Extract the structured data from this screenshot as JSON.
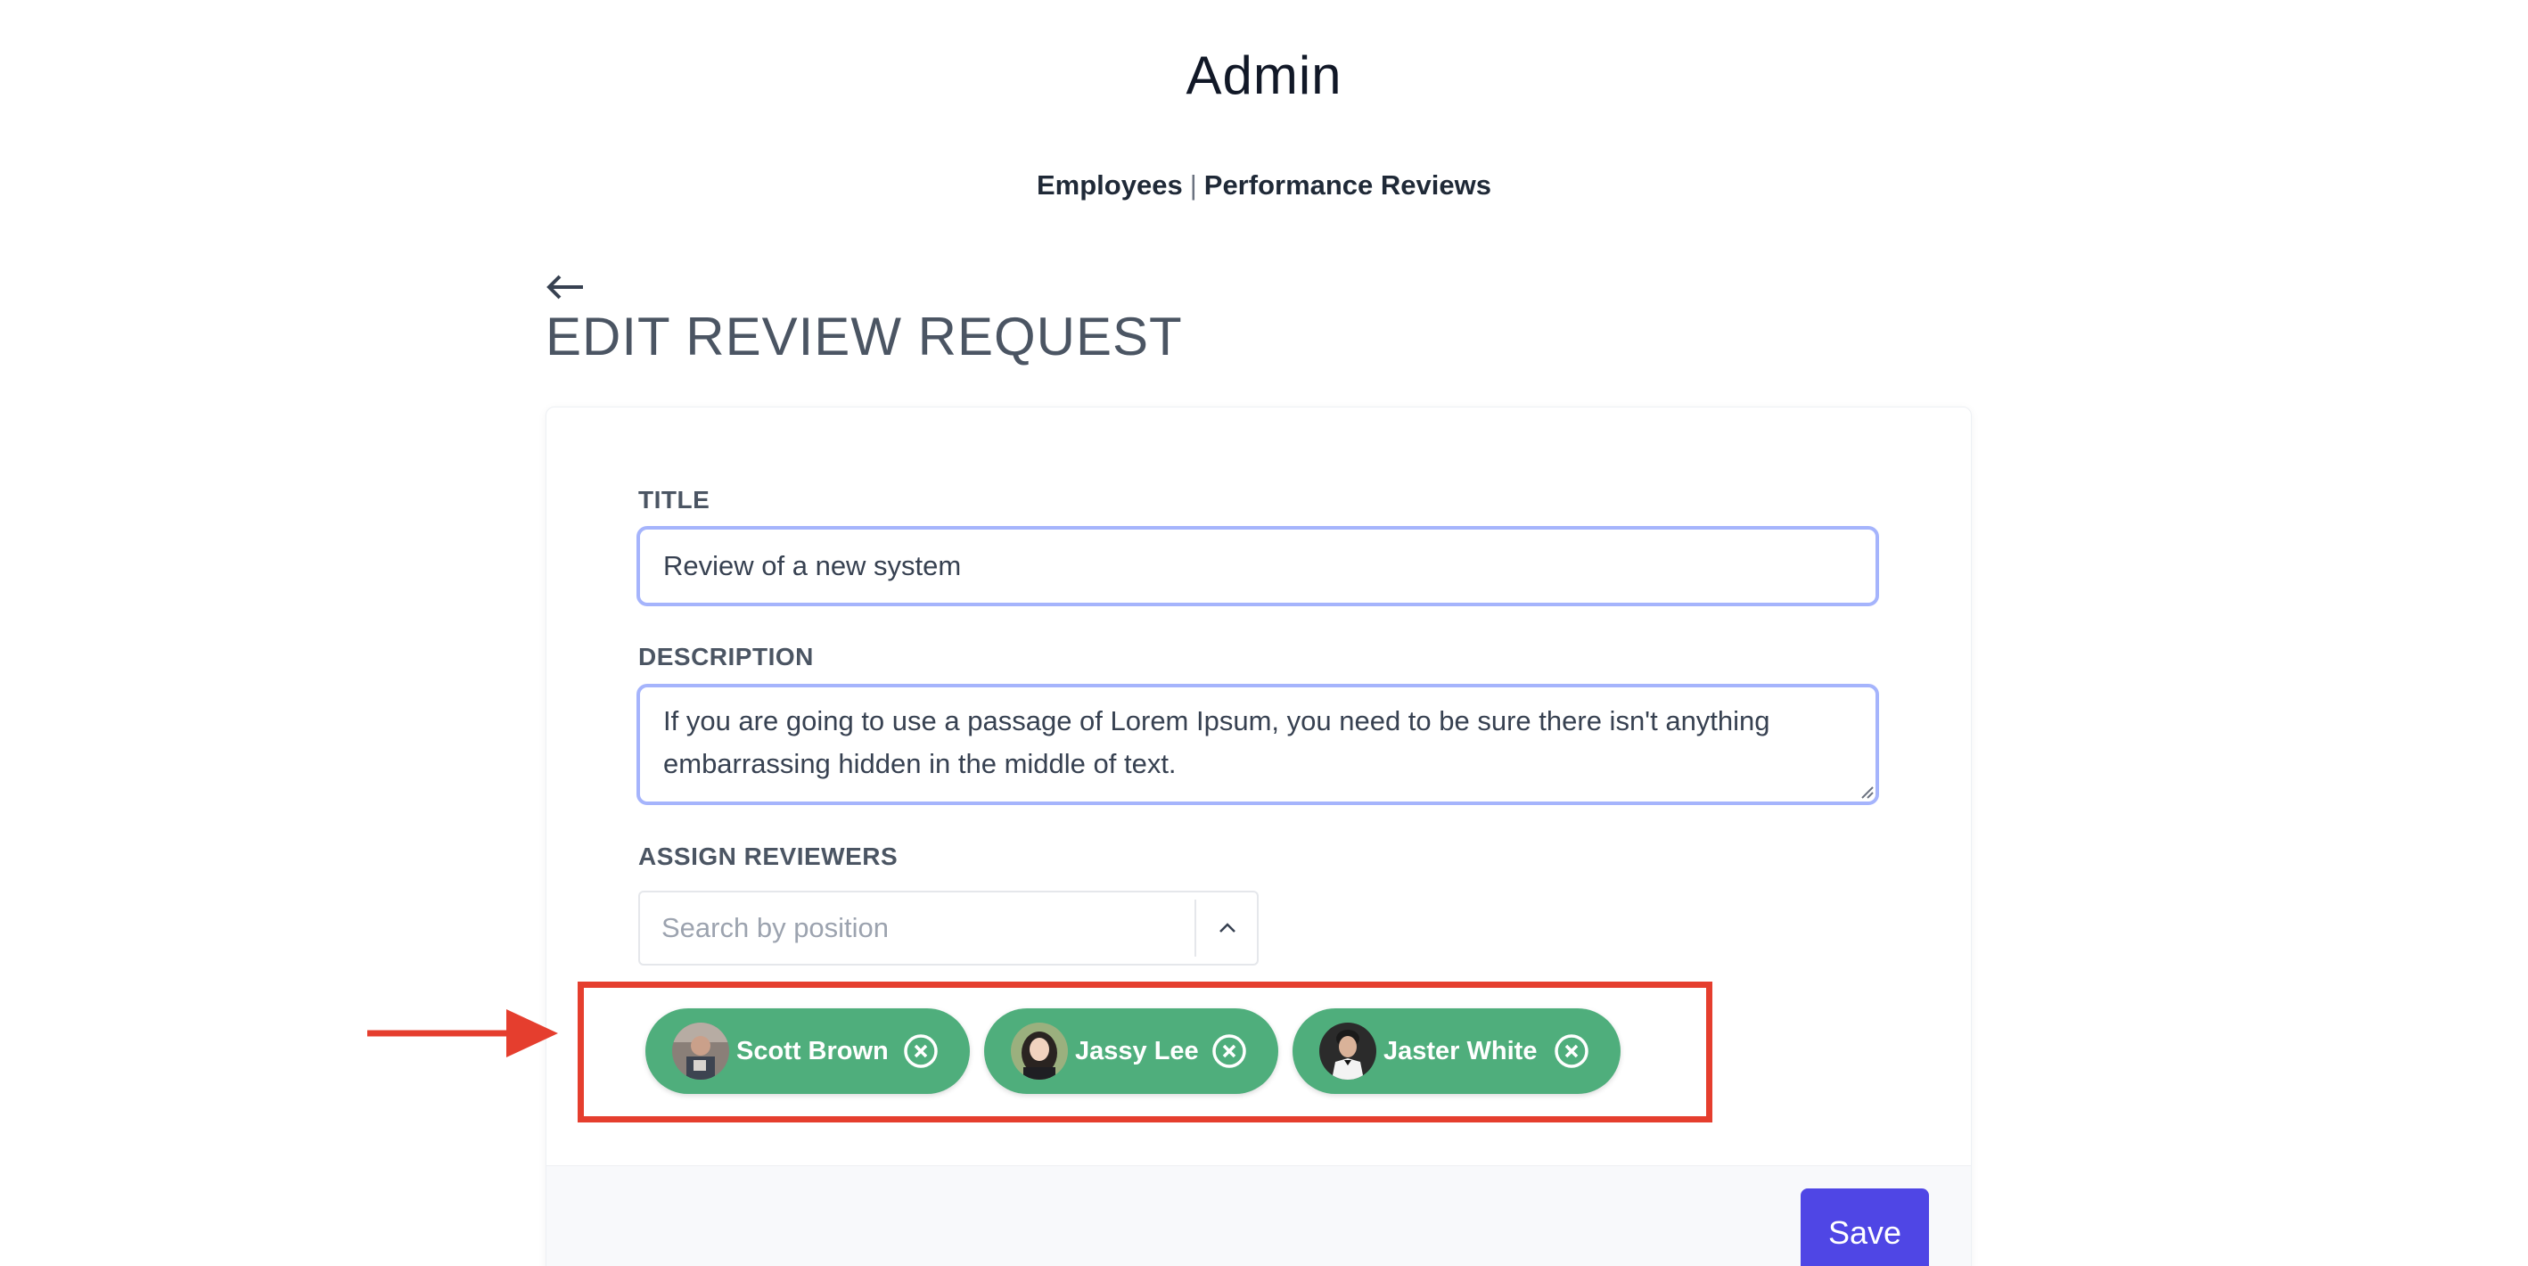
{
  "app": {
    "title": "Admin"
  },
  "nav": {
    "items": [
      {
        "label": "Employees"
      },
      {
        "label": "Performance Reviews"
      }
    ],
    "separator": "|"
  },
  "header": {
    "back_icon": "arrow-left-icon",
    "title": "EDIT REVIEW REQUEST"
  },
  "form": {
    "title": {
      "label": "TITLE",
      "value": "Review of a new system"
    },
    "description": {
      "label": "DESCRIPTION",
      "value": "If you are going to use a passage of Lorem Ipsum, you need to be sure there isn't anything embarrassing hidden in the middle of text."
    },
    "reviewers": {
      "label": "ASSIGN REVIEWERS",
      "search_placeholder": "Search by position",
      "dropdown_icon": "chevron-up-icon",
      "selected": [
        {
          "name": "Scott Brown",
          "avatar": "avatar-icon",
          "remove_icon": "close-circle-icon"
        },
        {
          "name": "Jassy Lee",
          "avatar": "avatar-icon",
          "remove_icon": "close-circle-icon"
        },
        {
          "name": "Jaster White",
          "avatar": "avatar-icon",
          "remove_icon": "close-circle-icon"
        }
      ]
    }
  },
  "actions": {
    "save_label": "Save"
  },
  "colors": {
    "chip": "#4fae7c",
    "primary": "#4f46e5",
    "input_focus_border": "#a5b4fc",
    "annotation": "#e53e2e"
  }
}
